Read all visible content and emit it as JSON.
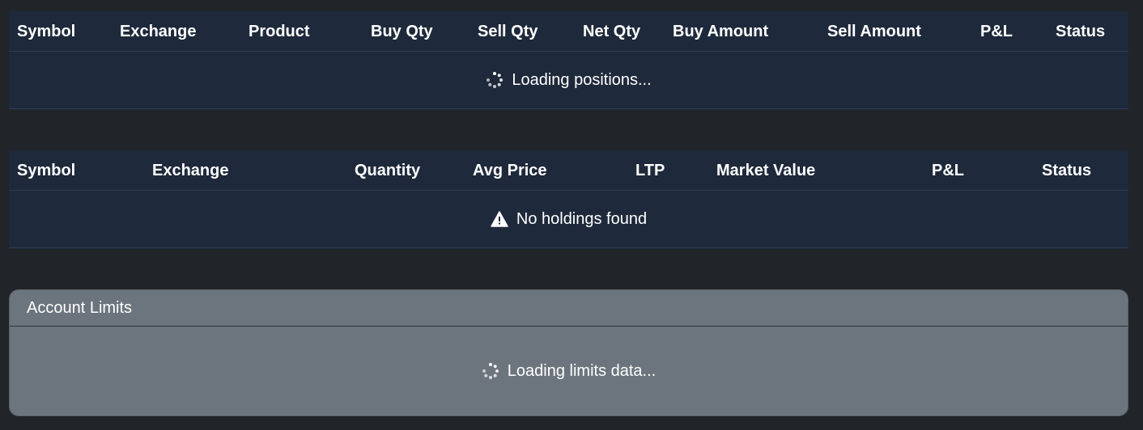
{
  "positions": {
    "columns": [
      "Symbol",
      "Exchange",
      "Product",
      "Buy Qty",
      "Sell Qty",
      "Net Qty",
      "Buy Amount",
      "Sell Amount",
      "P&L",
      "Status"
    ],
    "empty_message": "Loading positions...",
    "empty_icon": "spinner-icon"
  },
  "holdings": {
    "columns": [
      "Symbol",
      "Exchange",
      "Quantity",
      "Avg Price",
      "LTP",
      "Market Value",
      "P&L",
      "Status"
    ],
    "empty_message": "No holdings found",
    "empty_icon": "warning-icon"
  },
  "limits": {
    "title": "Account Limits",
    "loading_message": "Loading limits data...",
    "loading_icon": "spinner-icon"
  },
  "colors": {
    "page_bg": "#212429",
    "table_bg": "#1e293b",
    "card_bg": "#6c757d",
    "text": "#ffffff"
  }
}
